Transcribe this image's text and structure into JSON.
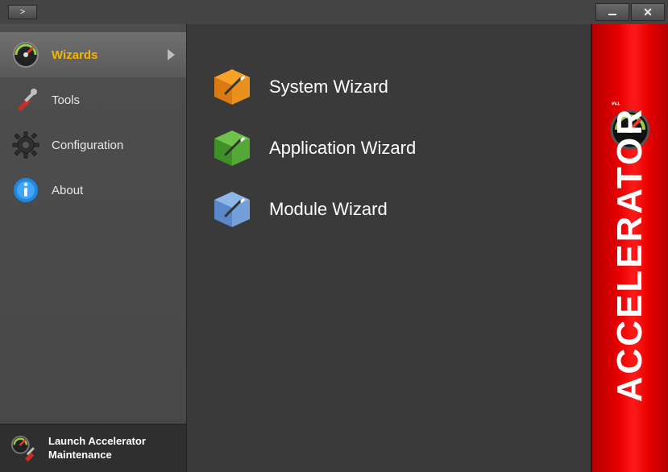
{
  "titlebar": {
    "collapse_label": ">"
  },
  "sidebar": {
    "items": [
      {
        "label": "Wizards"
      },
      {
        "label": "Tools"
      },
      {
        "label": "Configuration"
      },
      {
        "label": "About"
      }
    ],
    "maintenance_label": "Launch Accelerator\nMaintenance"
  },
  "main": {
    "wizards": [
      {
        "label": "System Wizard"
      },
      {
        "label": "Application Wizard"
      },
      {
        "label": "Module Wizard"
      }
    ]
  },
  "brand": {
    "name": "ACCELERATOR",
    "tm": "™"
  },
  "colors": {
    "accent": "#f5b400",
    "brand_red": "#e60000"
  }
}
